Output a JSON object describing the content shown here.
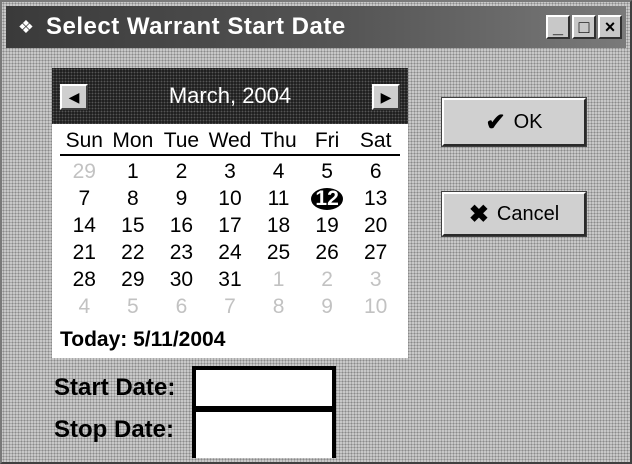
{
  "window": {
    "title": "Select Warrant Start Date",
    "icon": "app-icon",
    "controls": {
      "minimize": "_",
      "maximize": "□",
      "close": "×"
    }
  },
  "calendar": {
    "month_title": "March, 2004",
    "prev_icon": "◀",
    "next_icon": "▶",
    "days_of_week": [
      "Sun",
      "Mon",
      "Tue",
      "Wed",
      "Thu",
      "Fri",
      "Sat"
    ],
    "weeks": [
      [
        {
          "d": "29",
          "o": true
        },
        {
          "d": "1"
        },
        {
          "d": "2"
        },
        {
          "d": "3"
        },
        {
          "d": "4"
        },
        {
          "d": "5"
        },
        {
          "d": "6"
        }
      ],
      [
        {
          "d": "7"
        },
        {
          "d": "8"
        },
        {
          "d": "9"
        },
        {
          "d": "10"
        },
        {
          "d": "11"
        },
        {
          "d": "12",
          "selected": true
        },
        {
          "d": "13"
        }
      ],
      [
        {
          "d": "14"
        },
        {
          "d": "15"
        },
        {
          "d": "16"
        },
        {
          "d": "17"
        },
        {
          "d": "18"
        },
        {
          "d": "19"
        },
        {
          "d": "20"
        }
      ],
      [
        {
          "d": "21"
        },
        {
          "d": "22"
        },
        {
          "d": "23"
        },
        {
          "d": "24"
        },
        {
          "d": "25"
        },
        {
          "d": "26"
        },
        {
          "d": "27"
        }
      ],
      [
        {
          "d": "28"
        },
        {
          "d": "29"
        },
        {
          "d": "30"
        },
        {
          "d": "31"
        },
        {
          "d": "1",
          "o": true
        },
        {
          "d": "2",
          "o": true
        },
        {
          "d": "3",
          "o": true
        }
      ],
      [
        {
          "d": "4",
          "o": true
        },
        {
          "d": "5",
          "o": true
        },
        {
          "d": "6",
          "o": true
        },
        {
          "d": "7",
          "o": true
        },
        {
          "d": "8",
          "o": true
        },
        {
          "d": "9",
          "o": true
        },
        {
          "d": "10",
          "o": true
        }
      ]
    ],
    "today_label": "Today: 5/11/2004"
  },
  "buttons": {
    "ok_label": "OK",
    "ok_icon": "✔",
    "cancel_label": "Cancel",
    "cancel_icon": "✖"
  },
  "fields": {
    "start_label": "Start Date:",
    "start_value": "",
    "stop_label": "Stop Date:",
    "stop_value": ""
  }
}
